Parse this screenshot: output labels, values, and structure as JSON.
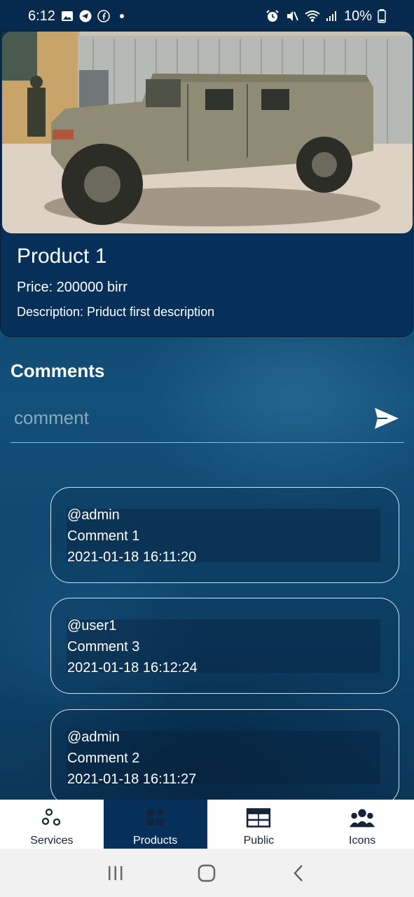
{
  "status_bar": {
    "time": "6:12",
    "battery": "10%",
    "left_icons": [
      "gallery-icon",
      "telegram-icon",
      "facebook-icon"
    ],
    "right_icons": [
      "alarm-icon",
      "mute-icon",
      "wifi-icon",
      "signal-icon",
      "battery-icon"
    ]
  },
  "product": {
    "title": "Product 1",
    "price": "Price: 200000 birr",
    "description": "Description: Priduct first description",
    "image_alt": "military vehicle photo"
  },
  "comments": {
    "heading": "Comments",
    "input": {
      "placeholder": "comment",
      "value": ""
    },
    "items": [
      {
        "user": "@admin",
        "text": "Comment 1",
        "time": "2021-01-18 16:11:20"
      },
      {
        "user": "@user1",
        "text": "Comment 3",
        "time": "2021-01-18 16:12:24"
      },
      {
        "user": "@admin",
        "text": "Comment 2",
        "time": "2021-01-18 16:11:27"
      }
    ]
  },
  "bottom_nav": {
    "active": "Products",
    "items": [
      {
        "label": "Services",
        "icon": "services-icon"
      },
      {
        "label": "Products",
        "icon": "products-icon"
      },
      {
        "label": "Public",
        "icon": "table-icon"
      },
      {
        "label": "Icons",
        "icon": "people-icon"
      }
    ]
  },
  "colors": {
    "header_card": "#06305a",
    "accent_white": "#ffffff",
    "nav_background": "#ffffff"
  }
}
